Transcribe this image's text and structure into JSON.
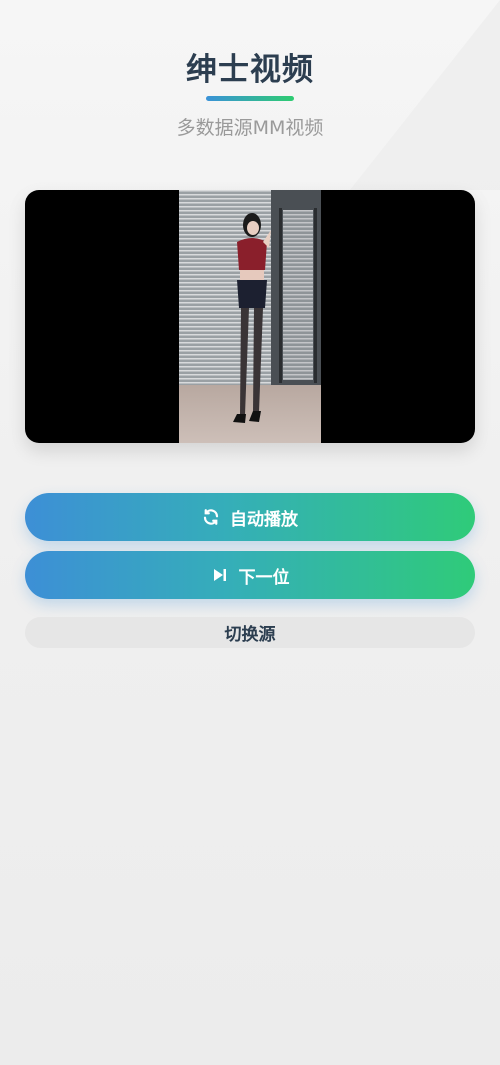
{
  "header": {
    "title": "绅士视频",
    "subtitle": "多数据源MM视频"
  },
  "colors": {
    "title": "#2c3e50",
    "accent_start": "#3d8fd6",
    "accent_end": "#2fcb79",
    "subtitle": "#9a9a9a"
  },
  "controls": {
    "autoplay_label": "自动播放",
    "autoplay_icon": "refresh-icon",
    "next_label": "下一位",
    "next_icon": "skip-next-icon",
    "switch_source_label": "切换源"
  }
}
